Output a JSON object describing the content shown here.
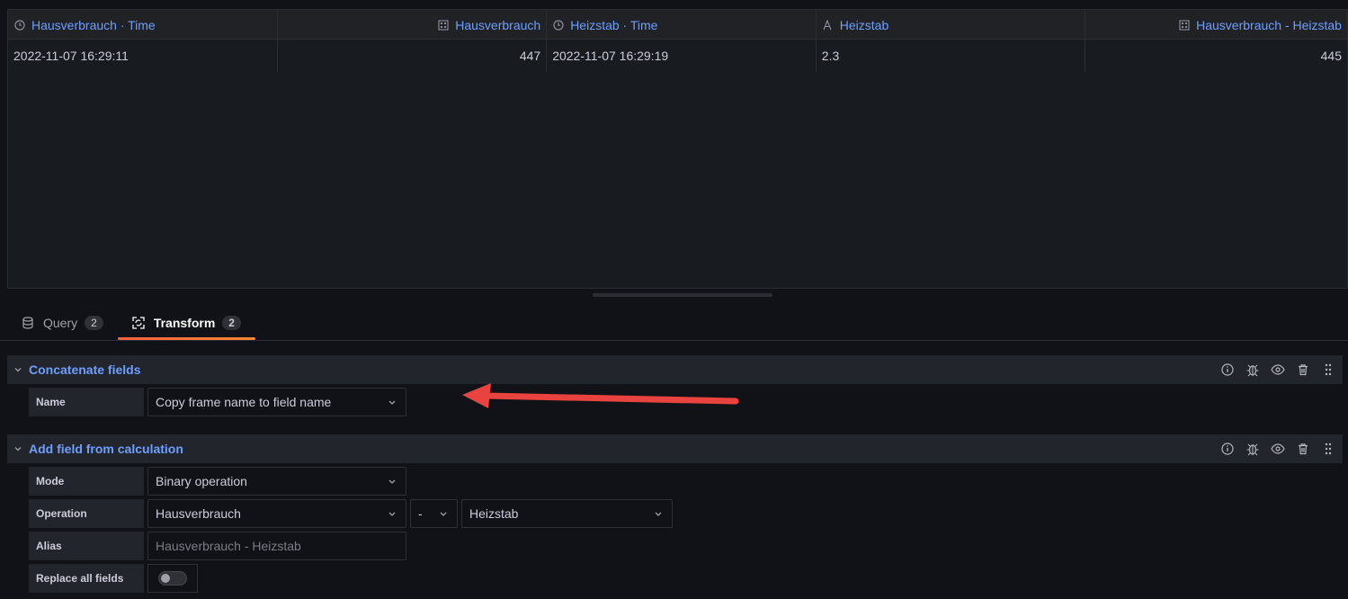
{
  "table": {
    "columns": [
      {
        "label": "Hausverbrauch · Time",
        "icon": "clock-icon",
        "align": "left"
      },
      {
        "label": "Hausverbrauch",
        "icon": "number-field-icon",
        "align": "right"
      },
      {
        "label": "Heizstab · Time",
        "icon": "clock-icon",
        "align": "left"
      },
      {
        "label": "Heizstab",
        "icon": "string-field-icon",
        "align": "left"
      },
      {
        "label": "Hausverbrauch - Heizstab",
        "icon": "number-field-icon",
        "align": "right"
      }
    ],
    "rows": [
      [
        "2022-11-07 16:29:11",
        "447",
        "2022-11-07 16:29:19",
        "2.3",
        "445"
      ]
    ]
  },
  "tabs": [
    {
      "label": "Query",
      "count": "2",
      "icon": "database-icon",
      "active": false
    },
    {
      "label": "Transform",
      "count": "2",
      "icon": "transform-icon",
      "active": true
    }
  ],
  "transforms": {
    "concat": {
      "title": "Concatenate fields",
      "name_label": "Name",
      "name_value": "Copy frame name to field name"
    },
    "calc": {
      "title": "Add field from calculation",
      "mode_label": "Mode",
      "mode_value": "Binary operation",
      "operation_label": "Operation",
      "op_left": "Hausverbrauch",
      "op_operator": "-",
      "op_right": "Heizstab",
      "alias_label": "Alias",
      "alias_placeholder": "Hausverbrauch - Heizstab",
      "replace_label": "Replace all fields",
      "replace_on": false
    }
  },
  "colors": {
    "accent_link": "#6e9fff",
    "tab_underline": "#f55f3e",
    "annotation_arrow": "#e8433e"
  }
}
